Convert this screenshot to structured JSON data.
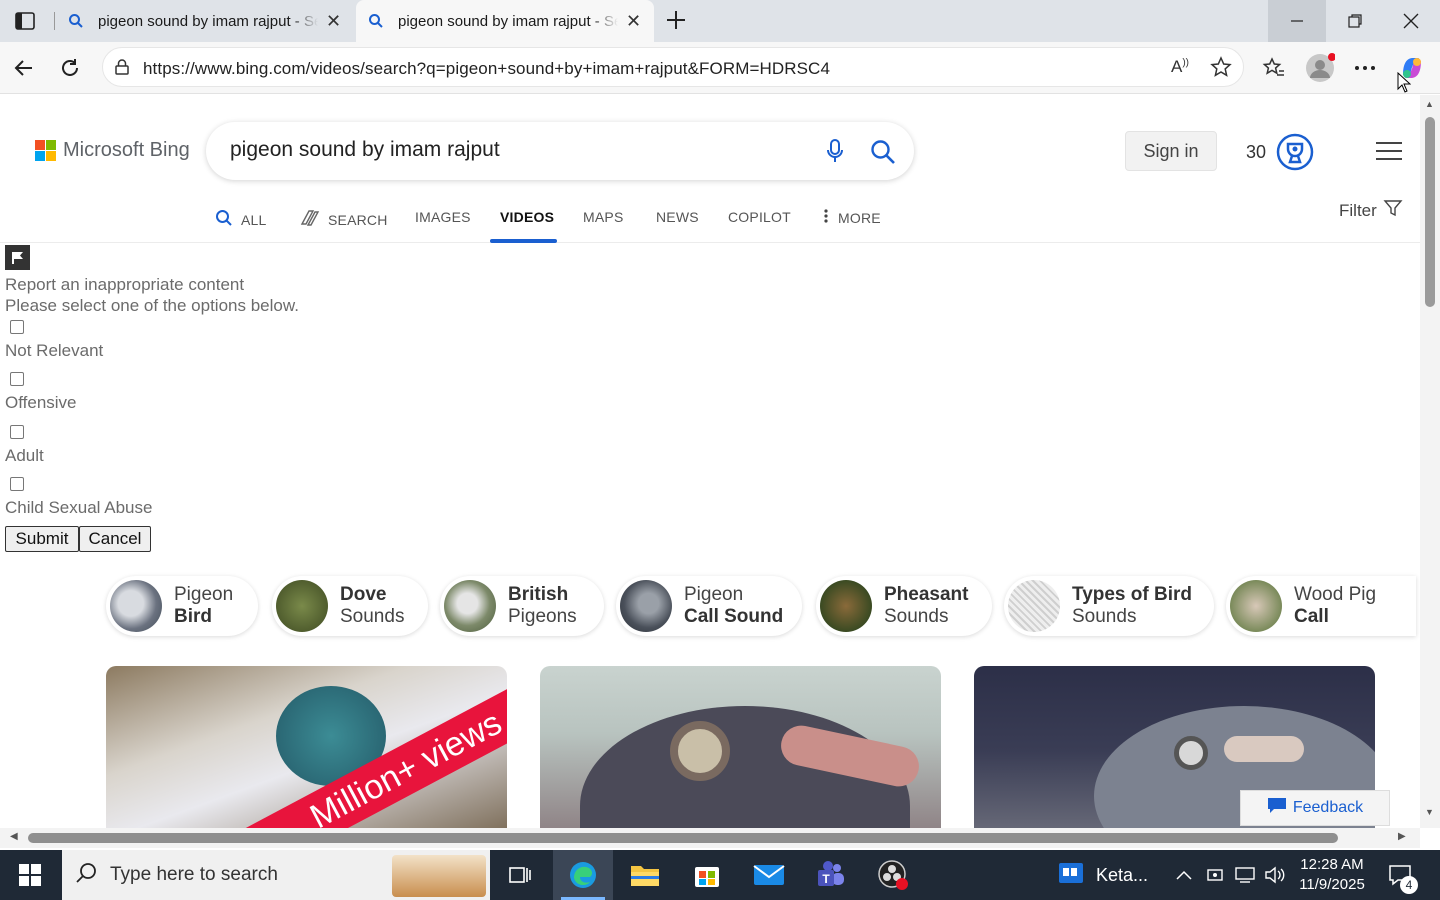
{
  "browser": {
    "tabs": [
      {
        "title": "pigeon sound by imam rajput - Search",
        "active": false
      },
      {
        "title": "pigeon sound by imam rajput - Search",
        "active": true
      }
    ],
    "url": "https://www.bing.com/videos/search?q=pigeon+sound+by+imam+rajput&FORM=HDRSC4",
    "icons": [
      "tab-actions-icon",
      "search-icon",
      "close-icon",
      "new-tab-icon",
      "minimize-icon",
      "restore-icon",
      "close-window-icon",
      "back-icon",
      "refresh-icon",
      "site-info-icon",
      "read-aloud-icon",
      "favorite-star-icon",
      "favorites-icon",
      "profile-icon",
      "more-icon",
      "copilot-icon"
    ]
  },
  "bing": {
    "logo_text": "Microsoft Bing",
    "query": "pigeon sound by imam rajput",
    "sign_in": "Sign in",
    "points": "30",
    "nav_tabs": [
      {
        "label": "ALL",
        "active": false
      },
      {
        "label": "SEARCH",
        "active": false
      },
      {
        "label": "IMAGES",
        "active": false
      },
      {
        "label": "VIDEOS",
        "active": true
      },
      {
        "label": "MAPS",
        "active": false
      },
      {
        "label": "NEWS",
        "active": false
      },
      {
        "label": "COPILOT",
        "active": false
      },
      {
        "label": "MORE",
        "active": false
      }
    ],
    "filter": "Filter",
    "report": {
      "title": "Report an inappropriate content",
      "subtitle": "Please select one of the options below.",
      "options": [
        "Not Relevant",
        "Offensive",
        "Adult",
        "Child Sexual Abuse"
      ],
      "submit": "Submit",
      "cancel": "Cancel"
    },
    "related": [
      {
        "line1": "Pigeon",
        "line2": "Bird",
        "bold": "line2"
      },
      {
        "line1": "Dove",
        "line2": "Sounds",
        "bold": "line1"
      },
      {
        "line1": "British",
        "line2": "Pigeons",
        "bold": "line1"
      },
      {
        "line1": "Pigeon",
        "line2": "Call Sound",
        "bold": "line2"
      },
      {
        "line1": "Pheasant",
        "line2": "Sounds",
        "bold": "line1"
      },
      {
        "line1": "Types of Bird",
        "line2": "Sounds",
        "bold": "line1"
      },
      {
        "line1": "Wood Pig",
        "line2": "Call",
        "bold": "line2"
      }
    ],
    "thumb_overlay": "Million+ views",
    "feedback": "Feedback"
  },
  "taskbar": {
    "search_placeholder": "Type here to search",
    "tray_app": "Keta...",
    "time": "12:28 AM",
    "date": "11/9/2025",
    "notifications": "4"
  }
}
